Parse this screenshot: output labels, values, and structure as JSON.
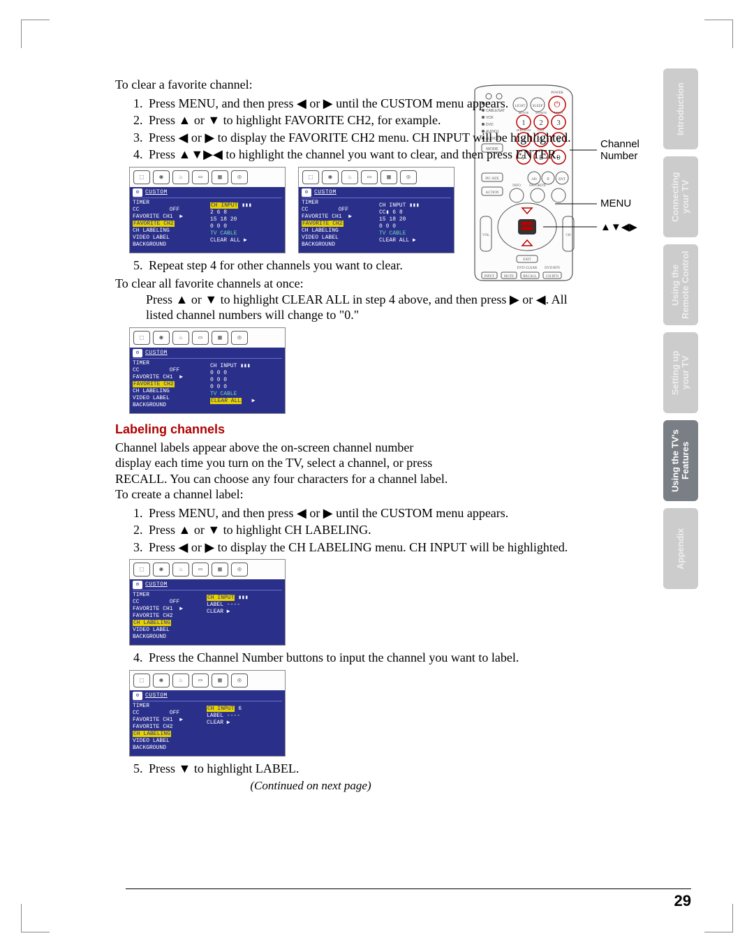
{
  "sideTabs": [
    {
      "label": "Introduction",
      "dark": false
    },
    {
      "label": "Connecting\nyour TV",
      "dark": false
    },
    {
      "label": "Using the\nRemote Control",
      "dark": false
    },
    {
      "label": "Setting up\nyour TV",
      "dark": false
    },
    {
      "label": "Using the TV's\nFeatures",
      "dark": true
    },
    {
      "label": "Appendix",
      "dark": false
    }
  ],
  "remote": {
    "label_channel": "Channel Number",
    "label_menu": "MENU",
    "label_arrows": "▲▼◀▶"
  },
  "section1": {
    "intro": "To clear a favorite channel:",
    "steps": [
      "Press MENU, and then press ◀ or ▶ until the CUSTOM menu appears.",
      "Press ▲ or ▼ to highlight FAVORITE CH2, for example.",
      "Press ◀ or ▶ to display the FAVORITE CH2 menu. CH INPUT will be highlighted.",
      "Press ▲▼▶◀ to highlight the channel you want to clear, and then press ENTER."
    ],
    "step5": "Repeat step 4 for other channels you want to clear.",
    "clearAllIntro": "To clear all favorite channels at once:",
    "clearAllBody": "Press ▲ or ▼ to highlight CLEAR ALL in step 4 above, and then press ▶ or ◀. All listed channel numbers will change to \"0.\""
  },
  "section2": {
    "head": "Labeling channels",
    "para": "Channel labels appear above the on-screen channel number display each time you turn on the TV, select a channel, or press RECALL. You can choose any four characters for a channel label.",
    "intro": "To create a channel label:",
    "steps": [
      "Press MENU, and then press ◀ or ▶ until the CUSTOM menu appears.",
      "Press ▲ or ▼ to highlight CH LABELING.",
      "Press ◀ or ▶ to display the CH LABELING menu. CH INPUT will be highlighted."
    ],
    "step4": "Press the Channel Number buttons to input the channel you want to label.",
    "step5": "Press ▼ to highlight LABEL.",
    "continued": "(Continued on next page)"
  },
  "osd": {
    "custom": "CUSTOM",
    "menu_left": "TIMER\nCC\nFAVORITE CH1\nFAVORITE CH2\nCH LABELING\nVIDEO LABEL\nBACKGROUND",
    "off": "OFF\n▶",
    "fav_right_a": "CH INPUT   ▮▮▮\n 2    6    8\n15   18   20\n 0    0    0\n        TV CABLE\nCLEAR ALL   ▶",
    "fav_right_b": "CH INPUT   ▮▮▮\nCC▮   6    8\n15   18   20\n 0    0    0\n        TV CABLE\nCLEAR ALL   ▶",
    "fav_right_c": "CH INPUT   ▮▮▮\n 0    0    0\n 0    0    0\n 0    0    0\n        TV CABLE\nCLEAR ALL   ▶",
    "lab_right_a": "CH INPUT   ▮▮▮\nLABEL    ----\nCLEAR       ▶",
    "lab_right_b": "CH INPUT     6\nLABEL    ----\nCLEAR       ▶"
  },
  "pageNumber": "29"
}
